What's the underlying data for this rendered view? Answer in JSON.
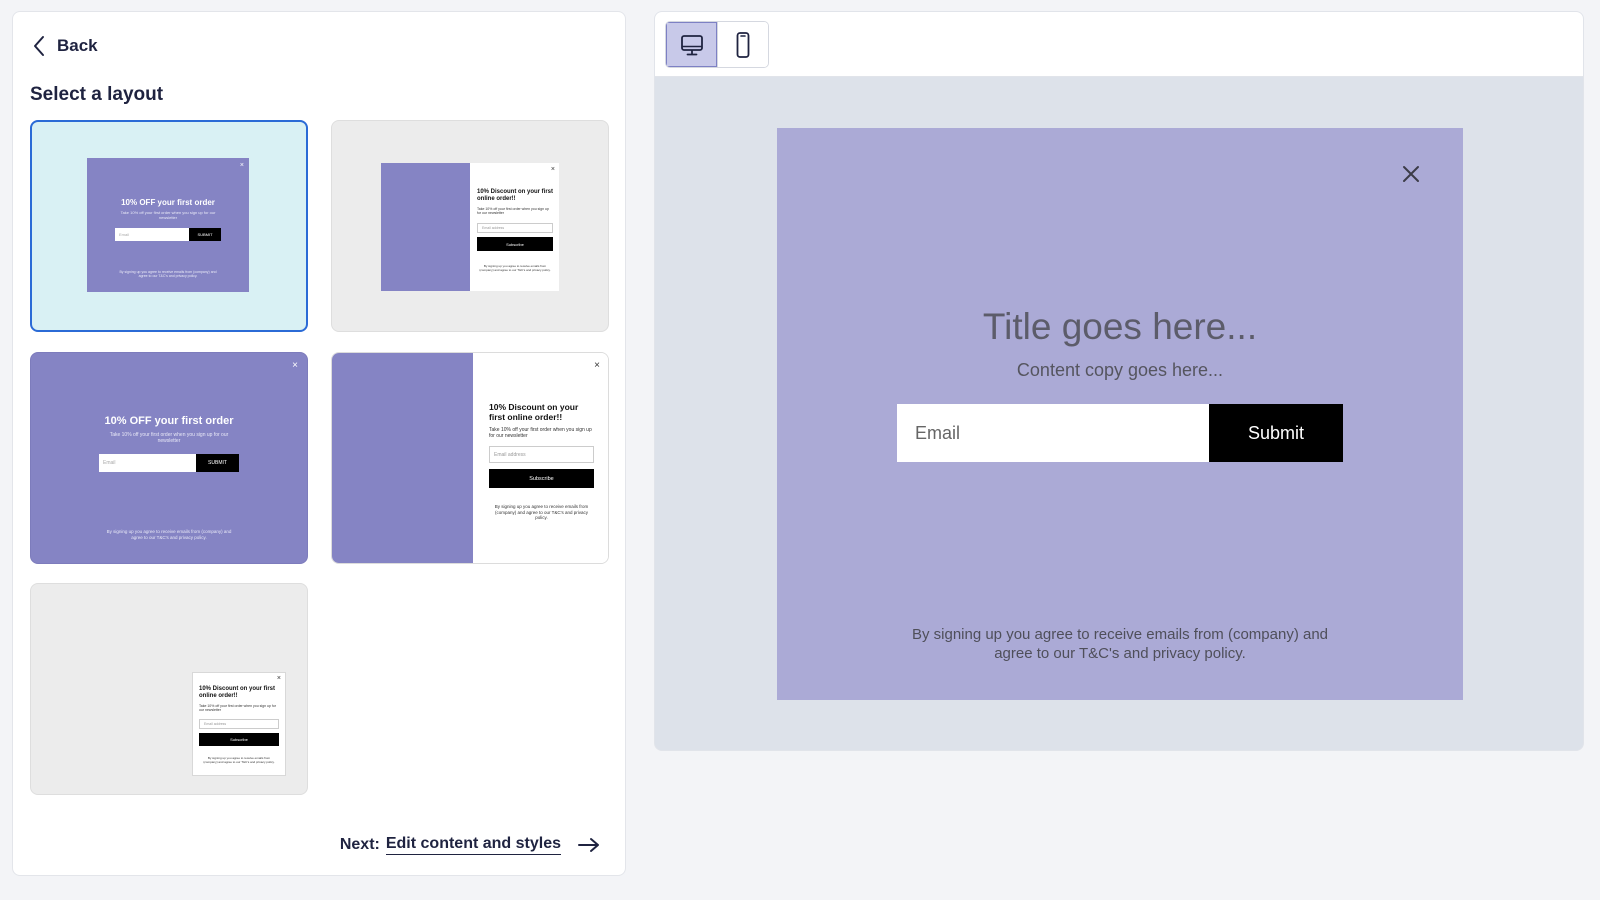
{
  "nav": {
    "back_label": "Back"
  },
  "layout_picker": {
    "title": "Select a layout",
    "templates": {
      "centered": {
        "title": "10% OFF your first order",
        "copy": "Take 10% off your first order when you sign up for our newsletter",
        "email_placeholder": "Email",
        "submit": "SUBMIT",
        "legal": "By signing up you agree to receive emails from (company) and agree to our T&C's and privacy policy."
      },
      "split": {
        "title": "10% Discount on your first online order!!",
        "copy": "Take 10% off your first order when you sign up for our newsletter",
        "email_placeholder": "Email address",
        "submit": "Subscribe",
        "legal": "By signing up you agree to receive emails from (company) and agree to our T&C's and privacy policy."
      },
      "close_glyph": "×"
    }
  },
  "footer": {
    "next_prefix": "Next:",
    "next_link": "Edit content and styles"
  },
  "preview": {
    "title": "Title goes here...",
    "copy": "Content copy goes here...",
    "email_placeholder": "Email",
    "submit_label": "Submit",
    "legal": "By signing up you agree to receive emails from (company) and agree to our T&C's and privacy policy."
  },
  "icons": {
    "back": "chevron-left-icon",
    "next": "arrow-right-icon",
    "desktop": "desktop-icon",
    "mobile": "mobile-icon",
    "close": "close-icon"
  },
  "colors": {
    "popup_violet": "#8584c4",
    "preview_bg": "#abaad6",
    "selected_card_bg": "#d9f1f4",
    "selected_border": "#2b6bd6"
  }
}
